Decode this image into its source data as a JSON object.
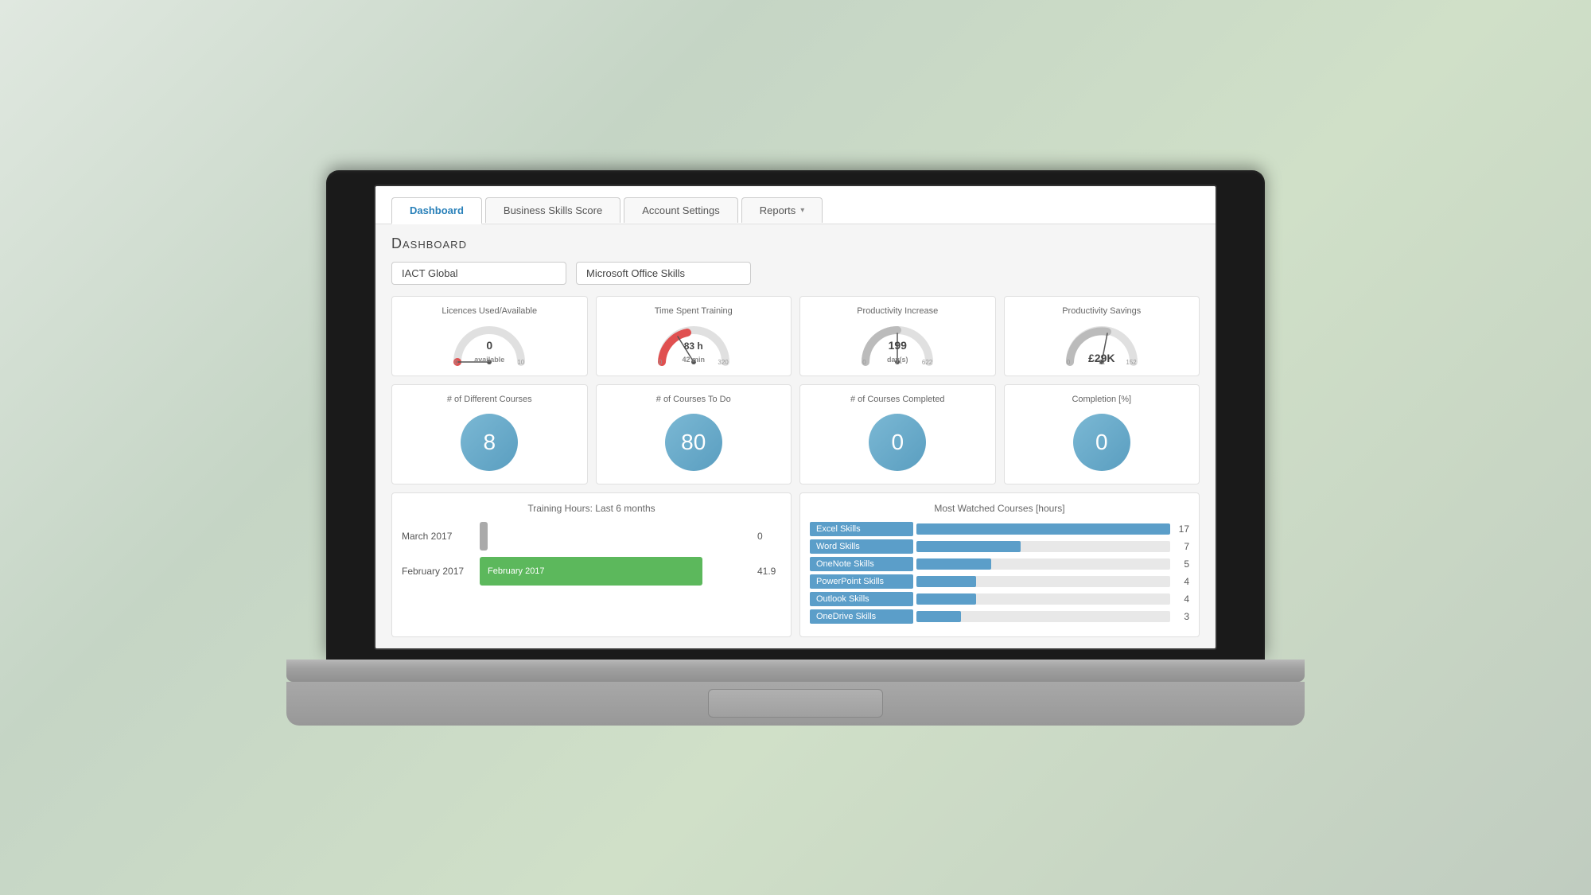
{
  "nav": {
    "tabs": [
      {
        "id": "dashboard",
        "label": "Dashboard",
        "active": true,
        "dropdown": false
      },
      {
        "id": "business-skills",
        "label": "Business Skills Score",
        "active": false,
        "dropdown": false
      },
      {
        "id": "account-settings",
        "label": "Account Settings",
        "active": false,
        "dropdown": false
      },
      {
        "id": "reports",
        "label": "Reports",
        "active": false,
        "dropdown": true
      }
    ]
  },
  "page": {
    "title": "Dashboard"
  },
  "dropdowns": {
    "company": "IACT Global",
    "course_group": "Microsoft Office Skills"
  },
  "metrics": [
    {
      "id": "licences",
      "title": "Licences Used/Available",
      "type": "gauge",
      "value": "0",
      "sublabel": "available",
      "min": "0",
      "max": "10",
      "mid": "",
      "color": "#e05050",
      "percent": 0
    },
    {
      "id": "time-spent",
      "title": "Time Spent Training",
      "type": "gauge",
      "value": "83 h",
      "sublabel": "42 min",
      "min": "0",
      "max": "320",
      "mid": "",
      "color": "#e05050",
      "percent": 26
    },
    {
      "id": "productivity-increase",
      "title": "Productivity Increase",
      "type": "gauge",
      "value": "199",
      "sublabel": "day(s)",
      "min": "0",
      "max": "622",
      "mid": "",
      "color": "#aaaaaa",
      "percent": 32
    },
    {
      "id": "productivity-savings",
      "title": "Productivity Savings",
      "type": "gauge",
      "value": "£29K",
      "sublabel": "",
      "min": "0",
      "max": "152",
      "mid": "72",
      "color": "#aaaaaa",
      "percent": 38
    }
  ],
  "counters": [
    {
      "id": "different-courses",
      "title": "# of Different Courses",
      "value": "8"
    },
    {
      "id": "courses-to-do",
      "title": "# of Courses To Do",
      "value": "80"
    },
    {
      "id": "courses-completed",
      "title": "# of Courses Completed",
      "value": "0"
    },
    {
      "id": "completion",
      "title": "Completion [%]",
      "value": "0"
    }
  ],
  "training_hours": {
    "title": "Training Hours: Last 6 months",
    "rows": [
      {
        "label": "March 2017",
        "value": 0,
        "max": 50,
        "color": "#aaaaaa",
        "display": "0"
      },
      {
        "label": "February 2017",
        "value": 41.9,
        "max": 50,
        "color": "#5cb85c",
        "display": "41.9"
      }
    ]
  },
  "most_watched": {
    "title": "Most Watched Courses [hours]",
    "max_value": 17,
    "courses": [
      {
        "name": "Excel Skills",
        "value": 17
      },
      {
        "name": "Word Skills",
        "value": 7
      },
      {
        "name": "OneNote Skills",
        "value": 5
      },
      {
        "name": "PowerPoint Skills",
        "value": 4
      },
      {
        "name": "Outlook Skills",
        "value": 4
      },
      {
        "name": "OneDrive Skills",
        "value": 3
      }
    ]
  }
}
